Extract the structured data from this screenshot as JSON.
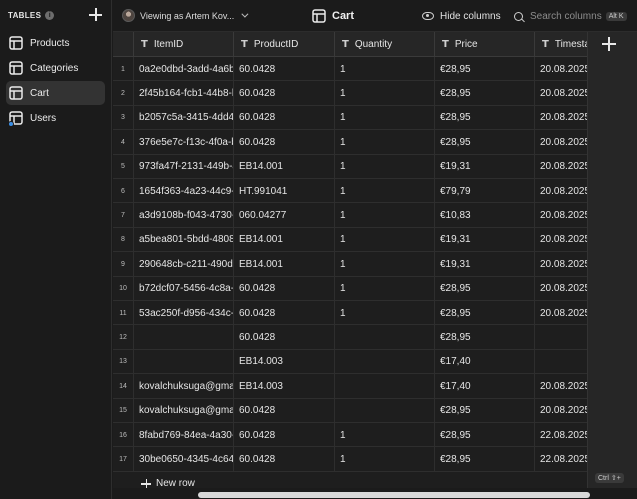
{
  "sidebar": {
    "title": "TABLES",
    "info": "i",
    "items": [
      {
        "label": "Products"
      },
      {
        "label": "Categories"
      },
      {
        "label": "Cart"
      },
      {
        "label": "Users"
      }
    ],
    "active_index": 2
  },
  "topbar": {
    "viewing_as": "Viewing as Artem Kov...",
    "table_title": "Cart",
    "hide_columns": "Hide columns",
    "search_placeholder": "Search columns",
    "search_shortcut": "Alt K"
  },
  "grid": {
    "columns": [
      "ItemID",
      "ProductID",
      "Quantity",
      "Price",
      "Timesta"
    ],
    "rows": [
      {
        "n": "1",
        "item": "0a2e0dbd-3add-4a6b-",
        "product": "60.0428",
        "qty": "1",
        "price": "€28,95",
        "ts": "20.08.2025"
      },
      {
        "n": "2",
        "item": "2f45b164-fcb1-44b8-b",
        "product": "60.0428",
        "qty": "1",
        "price": "€28,95",
        "ts": "20.08.2025"
      },
      {
        "n": "3",
        "item": "b2057c5a-3415-4dd4-",
        "product": "60.0428",
        "qty": "1",
        "price": "€28,95",
        "ts": "20.08.2025"
      },
      {
        "n": "4",
        "item": "376e5e7c-f13c-4f0a-b",
        "product": "60.0428",
        "qty": "1",
        "price": "€28,95",
        "ts": "20.08.2025"
      },
      {
        "n": "5",
        "item": "973fa47f-2131-449b-a",
        "product": "EB14.001",
        "qty": "1",
        "price": "€19,31",
        "ts": "20.08.2025"
      },
      {
        "n": "6",
        "item": "1654f363-4a23-44c9-",
        "product": "HT.991041",
        "qty": "1",
        "price": "€79,79",
        "ts": "20.08.2025"
      },
      {
        "n": "7",
        "item": "a3d9108b-f043-4730-",
        "product": "060.04277",
        "qty": "1",
        "price": "€10,83",
        "ts": "20.08.2025"
      },
      {
        "n": "8",
        "item": "a5bea801-5bdd-4808-",
        "product": "EB14.001",
        "qty": "1",
        "price": "€19,31",
        "ts": "20.08.2025"
      },
      {
        "n": "9",
        "item": "290648cb-c211-490d-",
        "product": "EB14.001",
        "qty": "1",
        "price": "€19,31",
        "ts": "20.08.2025"
      },
      {
        "n": "10",
        "item": "b72dcf07-5456-4c8a-",
        "product": "60.0428",
        "qty": "1",
        "price": "€28,95",
        "ts": "20.08.2025"
      },
      {
        "n": "11",
        "item": "53ac250f-d956-434c-",
        "product": "60.0428",
        "qty": "1",
        "price": "€28,95",
        "ts": "20.08.2025"
      },
      {
        "n": "12",
        "item": "",
        "product": "60.0428",
        "qty": "",
        "price": "€28,95",
        "ts": ""
      },
      {
        "n": "13",
        "item": "",
        "product": "EB14.003",
        "qty": "",
        "price": "€17,40",
        "ts": ""
      },
      {
        "n": "14",
        "item": "kovalchuksuga@gmail.",
        "product": "EB14.003",
        "qty": "",
        "price": "€17,40",
        "ts": "20.08.2025"
      },
      {
        "n": "15",
        "item": "kovalchuksuga@gmail.",
        "product": "60.0428",
        "qty": "",
        "price": "€28,95",
        "ts": "20.08.2025"
      },
      {
        "n": "16",
        "item": "8fabd769-84ea-4a30-",
        "product": "60.0428",
        "qty": "1",
        "price": "€28,95",
        "ts": "22.08.2025"
      },
      {
        "n": "17",
        "item": "30be0650-4345-4c64",
        "product": "60.0428",
        "qty": "1",
        "price": "€28,95",
        "ts": "22.08.2025"
      }
    ],
    "new_row": "New row",
    "add_shortcut": "Ctrl ⇧+"
  }
}
